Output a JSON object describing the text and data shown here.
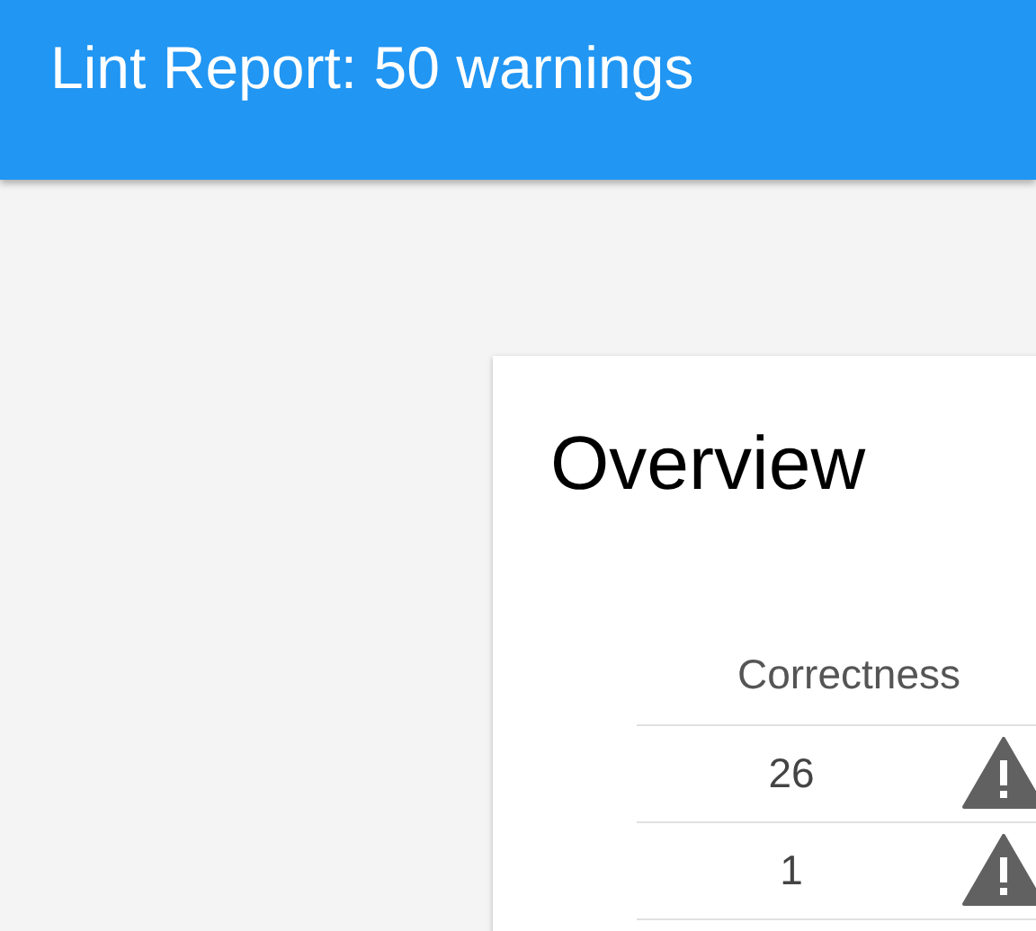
{
  "header": {
    "title": "Lint Report: 50 warnings"
  },
  "overview": {
    "title": "Overview",
    "table": {
      "columns": [
        "Correctness"
      ],
      "rows": [
        {
          "count": "26",
          "kind": "warning"
        },
        {
          "count": "1",
          "kind": "warning"
        }
      ]
    }
  }
}
